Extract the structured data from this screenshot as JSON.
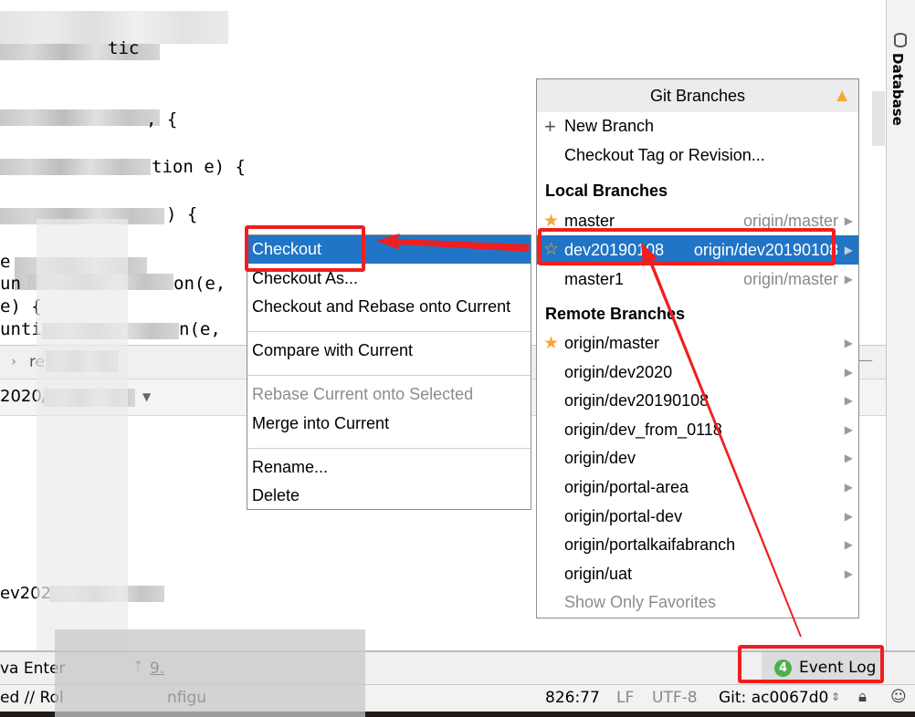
{
  "editor": {
    "lines": [
      "tic",
      ", {",
      "tion e) {",
      ") {",
      "e",
      "un",
      "on(e,",
      "e) {",
      "unti",
      "n(e,"
    ]
  },
  "tool_window": {
    "breadcrumb": "re",
    "branch_selector": "2020/",
    "content_line": "ev2020"
  },
  "right_sidebar": {
    "database_label": "Database"
  },
  "git_branches": {
    "title": "Git Branches",
    "warning_icon": "warning-triangle-icon",
    "actions": [
      {
        "label": "New Branch",
        "icon": "plus-icon"
      },
      {
        "label": "Checkout Tag or Revision..."
      }
    ],
    "local_header": "Local Branches",
    "local": [
      {
        "name": "master",
        "tracking": "origin/master",
        "favorite": true,
        "selected": false
      },
      {
        "name": "dev20190108",
        "tracking": "origin/dev20190108",
        "favorite": false,
        "selected": true
      },
      {
        "name": "master1",
        "tracking": "origin/master",
        "favorite": false,
        "selected": false
      }
    ],
    "remote_header": "Remote Branches",
    "remote": [
      {
        "name": "origin/master",
        "favorite": true
      },
      {
        "name": "origin/dev2020"
      },
      {
        "name": "origin/dev20190108"
      },
      {
        "name": "origin/dev_from_0118"
      },
      {
        "name": "origin/dev"
      },
      {
        "name": "origin/portal-area"
      },
      {
        "name": "origin/portal-dev"
      },
      {
        "name": "origin/portalkaifabranch"
      },
      {
        "name": "origin/uat"
      }
    ],
    "show_only_favorites": "Show Only Favorites"
  },
  "context_menu": {
    "items": [
      {
        "label": "Checkout",
        "selected": true
      },
      {
        "label": "Checkout As..."
      },
      {
        "label": "Checkout and Rebase onto Current"
      },
      {
        "label": "Compare with Current"
      },
      {
        "label": "Rebase Current onto Selected",
        "disabled": true
      },
      {
        "label": "Merge into Current"
      },
      {
        "label": "Rename..."
      },
      {
        "label": "Delete"
      }
    ]
  },
  "bottom_toolbar": {
    "left_tab": "va Enter",
    "second_tab": "9.",
    "event_log": "Event Log",
    "event_log_count": "4"
  },
  "status_bar": {
    "message": "ed // Rol",
    "message_tail": "nfigu",
    "position": "826:77",
    "line_sep": "LF",
    "encoding": "UTF-8",
    "git": "Git: ac0067d0"
  },
  "colors": {
    "selection": "#2075c7",
    "annotation": "#f01e1e",
    "star": "#f4a83a",
    "badge": "#4caf50"
  }
}
